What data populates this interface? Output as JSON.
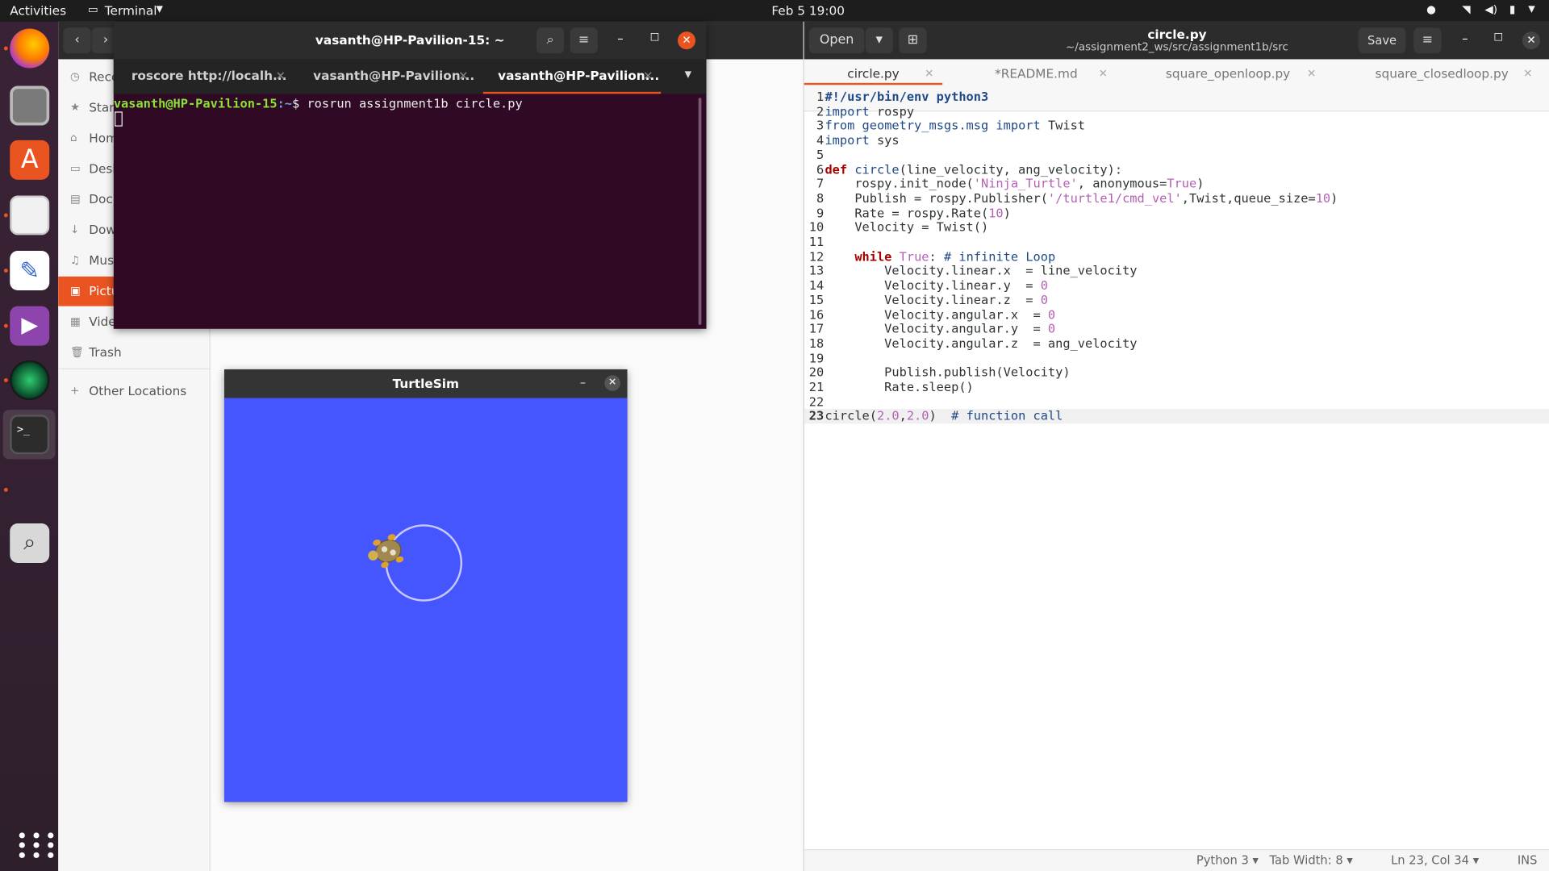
{
  "topbar": {
    "activities": "Activities",
    "app": "Terminal",
    "clock": "Feb 5  19:00"
  },
  "files": {
    "sidebar": [
      {
        "label": "Rece",
        "icon": "recent-icon"
      },
      {
        "label": "Star",
        "icon": "star-icon"
      },
      {
        "label": "Hom",
        "icon": "home-icon"
      },
      {
        "label": "Desk",
        "icon": "desktop-icon"
      },
      {
        "label": "Docu",
        "icon": "documents-icon"
      },
      {
        "label": "Dow",
        "icon": "downloads-icon"
      },
      {
        "label": "Musi",
        "icon": "music-icon"
      },
      {
        "label": "Pictu",
        "icon": "pictures-icon",
        "selected": true
      },
      {
        "label": "Vide",
        "icon": "videos-icon"
      },
      {
        "label": "Trash",
        "icon": "trash-icon"
      }
    ],
    "other_locations": "Other Locations"
  },
  "terminal": {
    "title": "vasanth@HP-Pavilion-15: ~",
    "tabs": [
      "roscore http://localh...",
      "vasanth@HP-Pavilion...",
      "vasanth@HP-Pavilion..."
    ],
    "prompt_user": "vasanth@HP-Pavilion-15",
    "prompt_path": ":~",
    "prompt_symbol": "$",
    "command": "rosrun assignment1b circle.py"
  },
  "turtlesim": {
    "title": "TurtleSim",
    "bg_color": "#4556ff"
  },
  "gedit": {
    "open_label": "Open",
    "title": "circle.py",
    "path": "~/assignment2_ws/src/assignment1b/src",
    "save_label": "Save",
    "tabs": [
      {
        "label": "circle.py",
        "active": true
      },
      {
        "label": "*README.md"
      },
      {
        "label": "square_openloop.py"
      },
      {
        "label": "square_closedloop.py"
      }
    ],
    "code": [
      "#!/usr/bin/env python3",
      "import rospy",
      "from geometry_msgs.msg import Twist",
      "import sys",
      "",
      "def circle(line_velocity, ang_velocity):",
      "    rospy.init_node('Ninja_Turtle', anonymous=True)",
      "    Publish = rospy.Publisher('/turtle1/cmd_vel',Twist,queue_size=10)",
      "    Rate = rospy.Rate(10)",
      "    Velocity = Twist()",
      "",
      "    while True: # infinite Loop",
      "        Velocity.linear.x  = line_velocity",
      "        Velocity.linear.y  = 0",
      "        Velocity.linear.z  = 0",
      "        Velocity.angular.x  = 0",
      "        Velocity.angular.y  = 0",
      "        Velocity.angular.z  = ang_velocity",
      "",
      "        Publish.publish(Velocity)",
      "        Rate.sleep()",
      "",
      "circle(2.0,2.0)  # function call"
    ],
    "current_line": 23,
    "status": {
      "language": "Python 3",
      "tab_width": "Tab Width: 8",
      "position": "Ln 23, Col 34",
      "mode": "INS"
    }
  }
}
